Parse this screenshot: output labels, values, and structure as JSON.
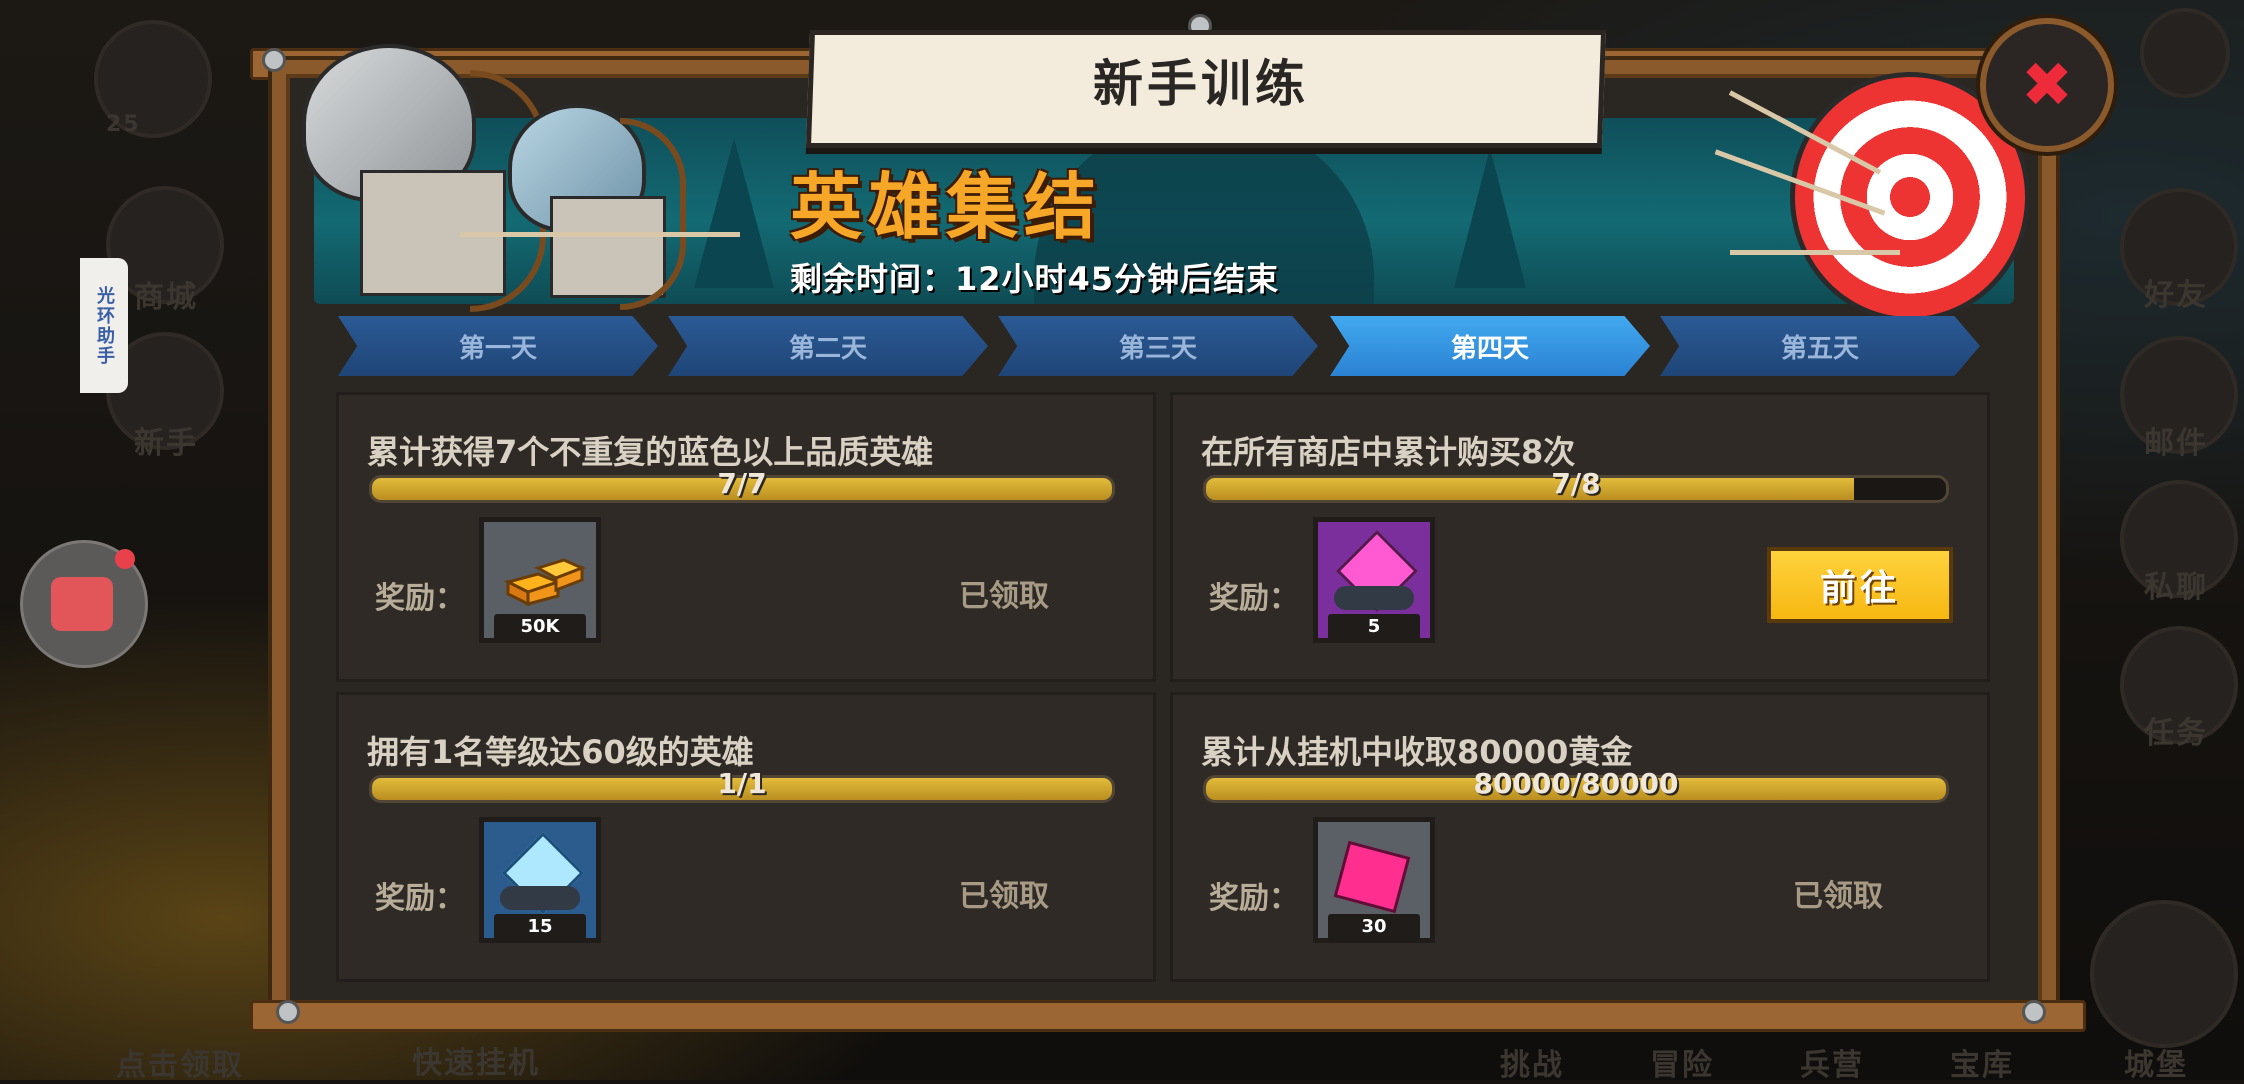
{
  "background": {
    "left_menu": [
      "商城",
      "新手",
      "点击领取",
      "快速挂机"
    ],
    "right_menu": [
      "好友",
      "邮件",
      "私聊",
      "任务",
      "城堡"
    ],
    "bottom_menu": [
      "挑战",
      "冒险",
      "兵营",
      "宝库"
    ],
    "level_badge": "25",
    "side_helper": "光环助手"
  },
  "dialog": {
    "title": "新手训练",
    "event_name": "英雄集结",
    "timer_text": "剩余时间：12小时45分钟后结束",
    "close_icon": "close-icon"
  },
  "tabs": [
    {
      "label": "第一天",
      "active": false
    },
    {
      "label": "第二天",
      "active": false
    },
    {
      "label": "第三天",
      "active": false
    },
    {
      "label": "第四天",
      "active": true
    },
    {
      "label": "第五天",
      "active": false
    }
  ],
  "reward_label": "奖励：",
  "tasks": [
    {
      "title": "累计获得7个不重复的蓝色以上品质英雄",
      "progress_text": "7/7",
      "progress": 1.0,
      "reward_icon": "gold-bars-icon",
      "reward_amount": "50K",
      "status": "已领取"
    },
    {
      "title": "在所有商店中累计购买8次",
      "progress_text": "7/8",
      "progress": 0.875,
      "reward_icon": "purple-gem-icon",
      "reward_amount": "5",
      "action": "前往"
    },
    {
      "title": "拥有1名等级达60级的英雄",
      "progress_text": "1/1",
      "progress": 1.0,
      "reward_icon": "blue-diamond-icon",
      "reward_amount": "15",
      "status": "已领取"
    },
    {
      "title": "累计从挂机中收取80000黄金",
      "progress_text": "80000/80000",
      "progress": 1.0,
      "reward_icon": "pink-gem-icon",
      "reward_amount": "30",
      "status": "已领取"
    }
  ],
  "colors": {
    "frame_wood": "#8a5a2c",
    "tab_active": "#41a9ef",
    "tab_inactive": "#2b5a95",
    "progress_fill": "#e3bb3b",
    "go_button": "#ffd23c",
    "event_title": "#f6a728",
    "close_x": "#ee2b3a"
  }
}
